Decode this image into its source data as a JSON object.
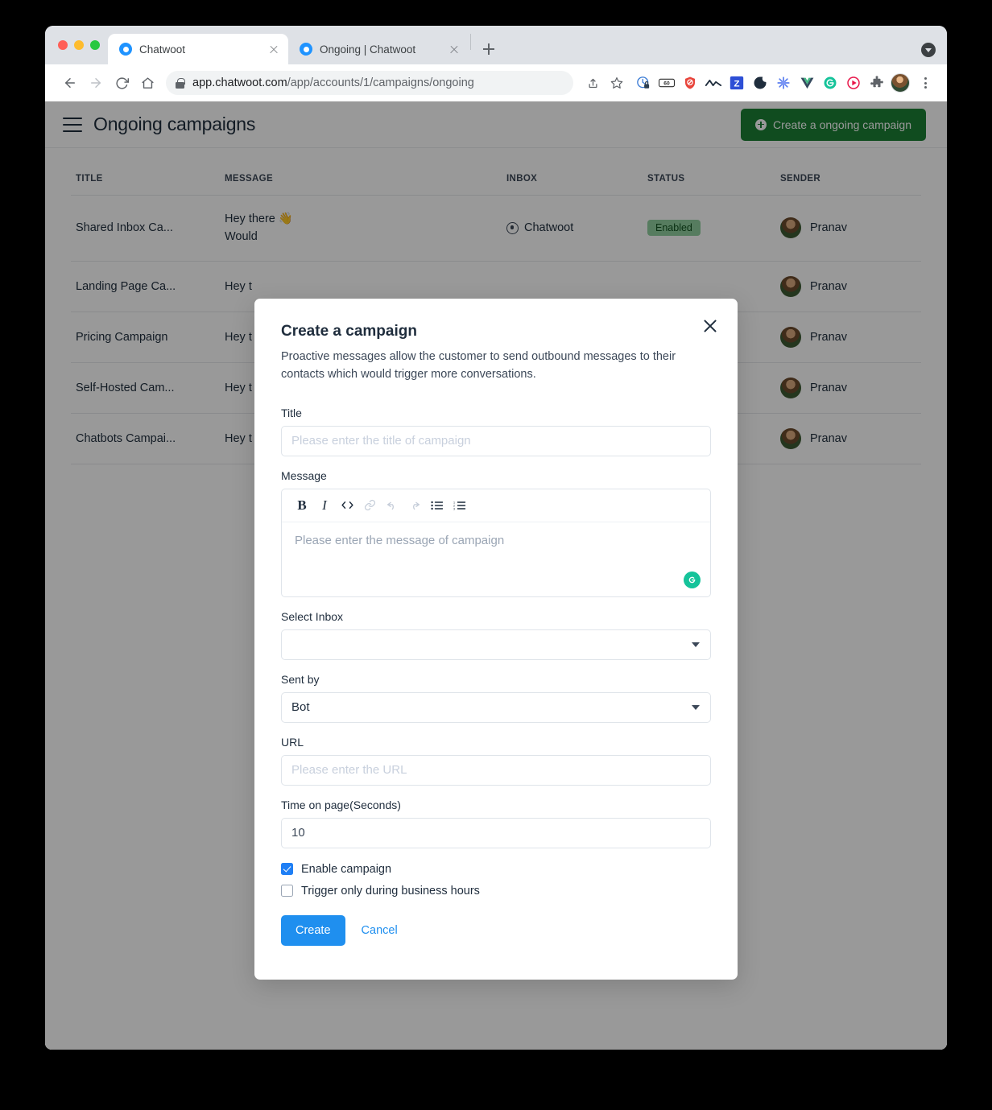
{
  "browser": {
    "tabs": [
      {
        "title": "Chatwoot",
        "active": true,
        "favicon": "chatwoot-logo-icon"
      },
      {
        "title": "Ongoing | Chatwoot",
        "active": false,
        "favicon": "chatwoot-logo-icon"
      }
    ],
    "new_tab_label": "+",
    "nav": {
      "back": "←",
      "forward": "→",
      "reload": "⟳",
      "home": "⌂"
    },
    "address": {
      "host": "app.chatwoot.com",
      "path": "/app/accounts/1/campaigns/ongoing",
      "full": "app.chatwoot.com/app/accounts/1/campaigns/ongoing",
      "lock": "lock-icon"
    },
    "omni_actions": [
      "share-icon",
      "bookmark-star-icon"
    ],
    "extensions": [
      "clock-lock-icon",
      "goo-icon",
      "shield-block-icon",
      "mountains-icon",
      "zotero-z-icon",
      "moon-swirl-icon",
      "asterisk-burst-icon",
      "vue-devtools-icon",
      "grammarly-icon",
      "play-circle-icon",
      "puzzle-extensions-icon"
    ],
    "profile_avatar": "user-avatar",
    "menu": "kebab-menu-icon",
    "tabstrip_download": "download-chevron-icon"
  },
  "page": {
    "title": "Ongoing campaigns",
    "menu_icon": "hamburger-menu-icon",
    "create_button": "Create a ongoing campaign"
  },
  "table": {
    "columns": [
      "TITLE",
      "MESSAGE",
      "INBOX",
      "STATUS",
      "SENDER"
    ],
    "rows": [
      {
        "title": "Shared Inbox Ca...",
        "message": "Hey there 👋\nWould",
        "inbox": "Chatwoot",
        "status": "Enabled",
        "sender": "Pranav"
      },
      {
        "title": "Landing Page Ca...",
        "message": "Hey t",
        "inbox": "",
        "status": "",
        "sender": "Pranav"
      },
      {
        "title": "Pricing Campaign",
        "message": "Hey t",
        "inbox": "",
        "status": "",
        "sender": "Pranav"
      },
      {
        "title": "Self-Hosted Cam...",
        "message": "Hey t",
        "inbox": "",
        "status": "",
        "sender": "Pranav"
      },
      {
        "title": "Chatbots Campai...",
        "message": "Hey t",
        "inbox": "",
        "status": "",
        "sender": "Pranav"
      }
    ]
  },
  "modal": {
    "title": "Create a campaign",
    "description": "Proactive messages allow the customer to send outbound messages to their contacts which would trigger more conversations.",
    "close_icon": "close-icon",
    "fields": {
      "title_label": "Title",
      "title_placeholder": "Please enter the title of campaign",
      "title_value": "",
      "message_label": "Message",
      "message_placeholder": "Please enter the message of campaign",
      "message_value": "",
      "inbox_label": "Select Inbox",
      "inbox_value": "",
      "sent_by_label": "Sent by",
      "sent_by_value": "Bot",
      "url_label": "URL",
      "url_placeholder": "Please enter the URL",
      "url_value": "",
      "time_label": "Time on page(Seconds)",
      "time_value": "10"
    },
    "editor_toolbar": [
      {
        "name": "bold-icon",
        "glyph": "B",
        "muted": false
      },
      {
        "name": "italic-icon",
        "glyph": "I",
        "muted": false
      },
      {
        "name": "code-icon",
        "glyph": "<>",
        "muted": false
      },
      {
        "name": "link-icon",
        "glyph": "🔗",
        "muted": true
      },
      {
        "name": "undo-icon",
        "glyph": "↰",
        "muted": true
      },
      {
        "name": "redo-icon",
        "glyph": "↱",
        "muted": true
      },
      {
        "name": "bullet-list-icon",
        "glyph": "☰",
        "muted": false
      },
      {
        "name": "ordered-list-icon",
        "glyph": "☷",
        "muted": false
      }
    ],
    "grammarly_badge": "G",
    "checkboxes": [
      {
        "label": "Enable campaign",
        "checked": true
      },
      {
        "label": "Trigger only during business hours",
        "checked": false
      }
    ],
    "submit_label": "Create",
    "cancel_label": "Cancel"
  },
  "colors": {
    "green_button": "#1b7f35",
    "blue_primary": "#1f8fef",
    "badge_bg": "#8fcf9f",
    "badge_text": "#11501f",
    "grammarly": "#15c39a",
    "checkbox_checked": "#1f7ff5"
  }
}
